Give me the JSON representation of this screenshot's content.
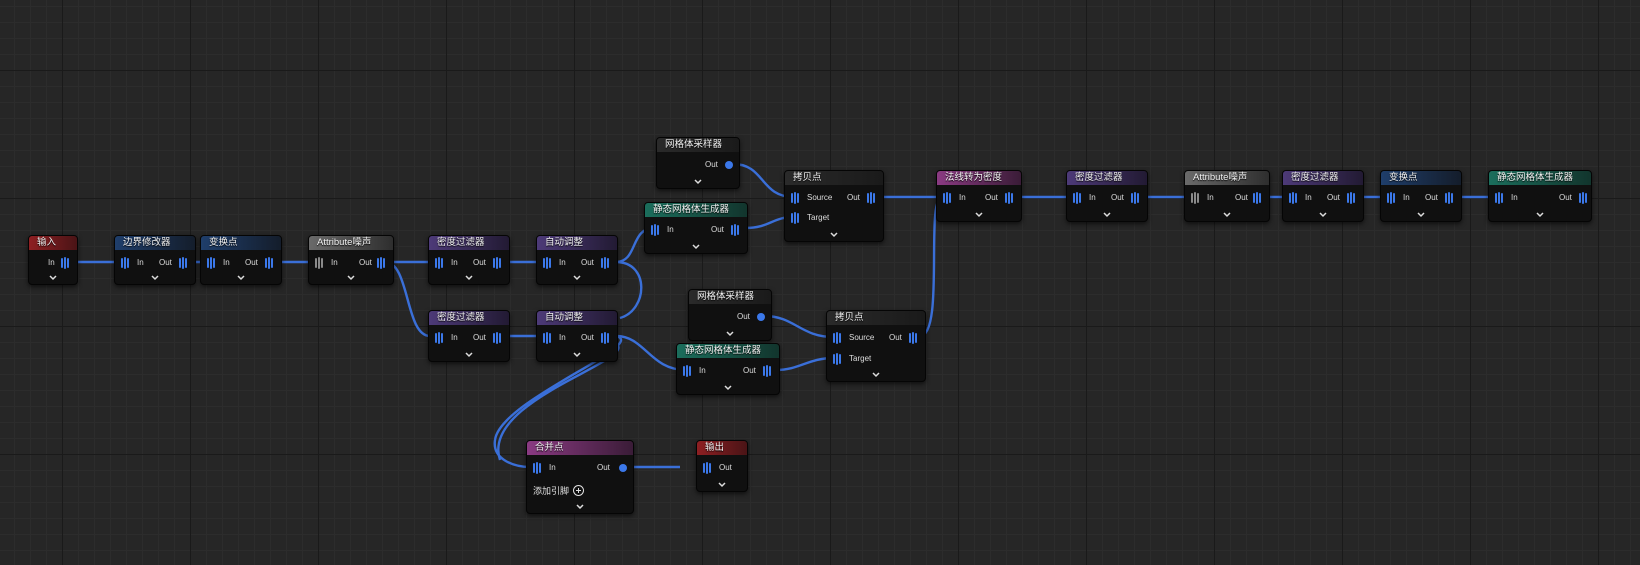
{
  "header_colors": {
    "red": "#8e1f22",
    "blue": "#1f3e6b",
    "gray": "#6a6a6a",
    "purple": "#4d3a78",
    "teal": "#1b6e5c",
    "pink": "#8a3a82"
  },
  "nodes": {
    "input": {
      "title": "输入",
      "out_label": "In"
    },
    "boundary": {
      "title": "边界修改器",
      "in_label": "In",
      "out_label": "Out"
    },
    "transform1": {
      "title": "变换点",
      "in_label": "In",
      "out_label": "Out"
    },
    "attr_noise1": {
      "title": "Attribute噪声",
      "in_label": "In",
      "out_label": "Out"
    },
    "density1": {
      "title": "密度过滤器",
      "in_label": "In",
      "out_label": "Out"
    },
    "density2": {
      "title": "密度过滤器",
      "in_label": "In",
      "out_label": "Out"
    },
    "auto1": {
      "title": "自动调整",
      "in_label": "In",
      "out_label": "Out"
    },
    "auto2": {
      "title": "自动调整",
      "in_label": "In",
      "out_label": "Out"
    },
    "mesh_sampler1": {
      "title": "网格体采样器",
      "out_label": "Out"
    },
    "static_gen1": {
      "title": "静态网格体生成器",
      "in_label": "In",
      "out_label": "Out"
    },
    "copy1": {
      "title": "拷贝点",
      "source_label": "Source",
      "target_label": "Target",
      "out_label": "Out"
    },
    "mesh_sampler2": {
      "title": "网格体采样器",
      "out_label": "Out"
    },
    "static_gen2": {
      "title": "静态网格体生成器",
      "in_label": "In",
      "out_label": "Out"
    },
    "copy2": {
      "title": "拷贝点",
      "source_label": "Source",
      "target_label": "Target",
      "out_label": "Out"
    },
    "normal_density": {
      "title": "法线转为密度",
      "in_label": "In",
      "out_label": "Out"
    },
    "density3": {
      "title": "密度过滤器",
      "in_label": "In",
      "out_label": "Out"
    },
    "attr_noise2": {
      "title": "Attribute噪声",
      "in_label": "In",
      "out_label": "Out"
    },
    "density4": {
      "title": "密度过滤器",
      "in_label": "In",
      "out_label": "Out"
    },
    "transform2": {
      "title": "变换点",
      "in_label": "In",
      "out_label": "Out"
    },
    "static_gen3": {
      "title": "静态网格体生成器",
      "in_label": "In",
      "out_label": "Out"
    },
    "merge": {
      "title": "合并点",
      "in_label": "In",
      "out_label": "Out",
      "add_pin_label": "添加引脚"
    },
    "output": {
      "title": "输出",
      "out_label": "Out"
    }
  }
}
